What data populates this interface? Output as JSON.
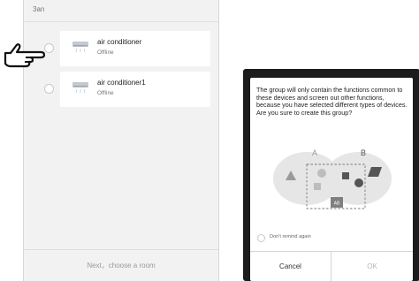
{
  "left_screen": {
    "group_name": "3an",
    "devices": [
      {
        "name": "air conditioner",
        "status": "Offline"
      },
      {
        "name": "air conditioner1",
        "status": "Offline"
      }
    ],
    "next_label": "Next，choose a room"
  },
  "dialog": {
    "message": "The group will only contain the functions common to these devices and screen out other functions, because you have selected different types of devices. Are you sure to create this group?",
    "venn": {
      "label_a": "A",
      "label_b": "B",
      "label_ab": "AB"
    },
    "remind_label": "Don't remind again",
    "cancel_label": "Cancel",
    "ok_label": "OK"
  },
  "icons": {
    "device": "air-conditioner-icon",
    "pointer": "hand-pointer-icon"
  },
  "colors": {
    "dialog_backdrop": "#1c1c1c",
    "ok_disabled": "#b5b5b5",
    "venn_fill": "#e6e6e6",
    "venn_shape": "#9a9a9a",
    "ab_box": "#7f7f7f"
  }
}
